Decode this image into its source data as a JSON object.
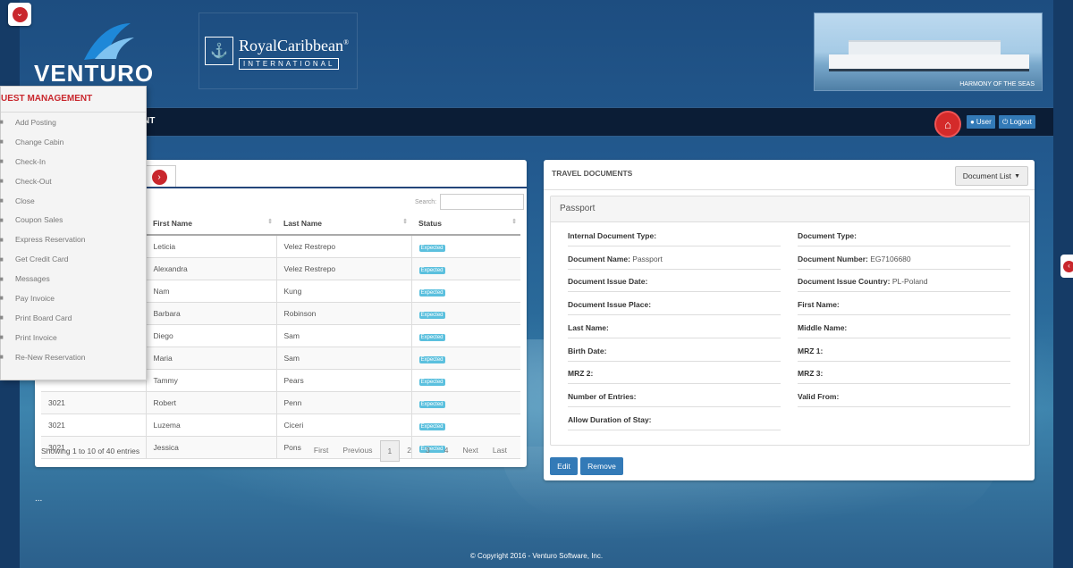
{
  "brand": {
    "venturo": "VENTURO",
    "royal_name": "RoyalCaribbean",
    "royal_sub": "INTERNATIONAL",
    "royal_reg": "®",
    "ship_caption": "HARMONY OF THE SEAS"
  },
  "navbar": {
    "title_fragment": "NT",
    "user_label": "User",
    "logout_label": "Logout"
  },
  "guest_menu": {
    "title": "UEST MANAGEMENT",
    "items": [
      "Add Posting",
      "Change Cabin",
      "Check-In",
      "Check-Out",
      "Close",
      "Coupon Sales",
      "Express Reservation",
      "Get Credit Card",
      "Messages",
      "Pay Invoice",
      "Print Board Card",
      "Print Invoice",
      "Re-New Reservation"
    ]
  },
  "guests": {
    "search_label": "Search:",
    "search_value": "",
    "columns": [
      "",
      "First Name",
      "Last Name",
      "Status"
    ],
    "rows": [
      {
        "id": "",
        "first": "Leticia",
        "last": "Velez Restrepo",
        "status": "Expected"
      },
      {
        "id": "",
        "first": "Alexandra",
        "last": "Velez Restrepo",
        "status": "Expected"
      },
      {
        "id": "",
        "first": "Nam",
        "last": "Kung",
        "status": "Expected"
      },
      {
        "id": "",
        "first": "Barbara",
        "last": "Robinson",
        "status": "Expected"
      },
      {
        "id": "",
        "first": "Diego",
        "last": "Sam",
        "status": "Expected"
      },
      {
        "id": "",
        "first": "Maria",
        "last": "Sam",
        "status": "Expected"
      },
      {
        "id": "",
        "first": "Tammy",
        "last": "Pears",
        "status": "Expected"
      },
      {
        "id": "3021",
        "first": "Robert",
        "last": "Penn",
        "status": "Expected"
      },
      {
        "id": "3021",
        "first": "Luzema",
        "last": "Ciceri",
        "status": "Expected"
      },
      {
        "id": "3021",
        "first": "Jessica",
        "last": "Pons",
        "status": "Expected"
      }
    ],
    "showing": "Showing 1 to 10 of 40 entries",
    "pager": {
      "first": "First",
      "previous": "Previous",
      "pages": [
        "1",
        "2",
        "3",
        "4"
      ],
      "next": "Next",
      "last": "Last",
      "current": "1"
    }
  },
  "documents": {
    "title": "TRAVEL DOCUMENTS",
    "list_button": "Document List",
    "section": "Passport",
    "left_fields": [
      {
        "label": "Internal Document Type:",
        "value": ""
      },
      {
        "label": "Document Name:",
        "value": "Passport"
      },
      {
        "label": "Document Issue Date:",
        "value": ""
      },
      {
        "label": "Document Issue Place:",
        "value": ""
      },
      {
        "label": "Last Name:",
        "value": ""
      },
      {
        "label": "Birth Date:",
        "value": ""
      },
      {
        "label": "MRZ 2:",
        "value": ""
      },
      {
        "label": "Number of Entries:",
        "value": ""
      },
      {
        "label": "Allow Duration of Stay:",
        "value": ""
      }
    ],
    "right_fields": [
      {
        "label": "Document Type:",
        "value": ""
      },
      {
        "label": "Document Number:",
        "value": "EG7106680"
      },
      {
        "label": "Document Issue Country:",
        "value": "PL-Poland"
      },
      {
        "label": "First Name:",
        "value": ""
      },
      {
        "label": "Middle Name:",
        "value": ""
      },
      {
        "label": "MRZ 1:",
        "value": ""
      },
      {
        "label": "MRZ 3:",
        "value": ""
      },
      {
        "label": "Valid From:",
        "value": ""
      }
    ],
    "edit_label": "Edit",
    "remove_label": "Remove"
  },
  "misc": {
    "dots": "...",
    "copyright": "© Copyright 2016 - Venturo Software, Inc."
  },
  "colors": {
    "accent_red": "#c9272d",
    "primary_blue": "#337ab7",
    "badge_info": "#5bc0de",
    "navbar": "#0b1d36"
  }
}
